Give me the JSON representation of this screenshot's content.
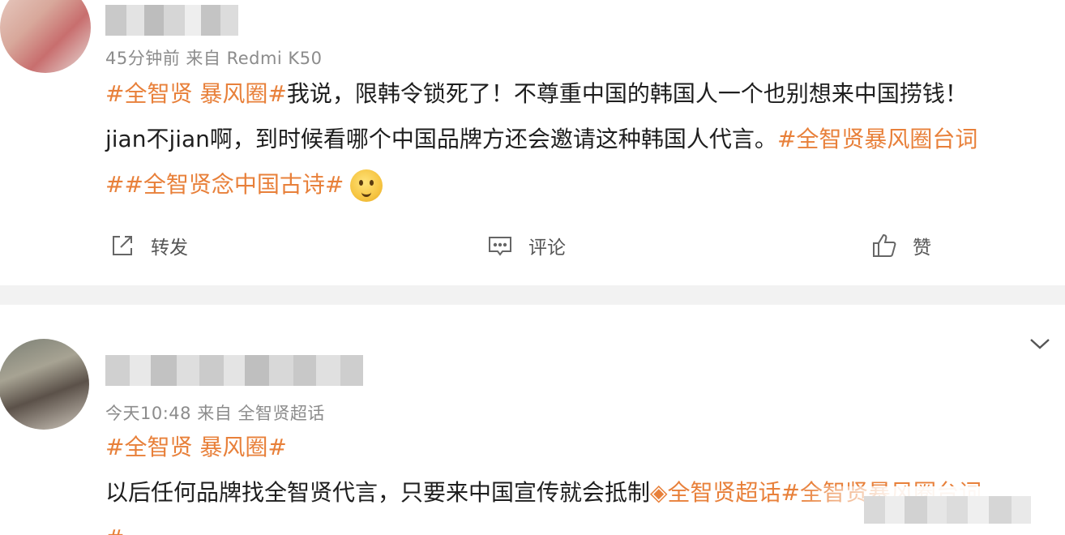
{
  "posts": [
    {
      "meta": "45分钟前  来自 Redmi K50",
      "text_lines": [
        [
          {
            "t": "#全智贤 暴风圈#",
            "tag": true
          },
          {
            "t": "我说，限韩令锁死了！不尊重中国的韩国人一个也别想来中国捞钱！",
            "tag": false
          }
        ],
        [
          {
            "t": "jian不jian啊，到时候看哪个中国品牌方还会邀请这种韩国人代言。",
            "tag": false
          },
          {
            "t": "#全智贤暴风圈台词",
            "tag": true
          }
        ],
        [
          {
            "t": "##全智贤念中国古诗#",
            "tag": true
          }
        ]
      ],
      "actions": {
        "forward_label": "转发",
        "comment_label": "评论",
        "like_label": "赞"
      }
    },
    {
      "meta": "今天10:48  来自 全智贤超话",
      "text_lines": [
        [
          {
            "t": "#全智贤 暴风圈#",
            "tag": true
          }
        ],
        [
          {
            "t": "以后任何品牌找全智贤代言，只要来中国宣传就会抵制",
            "tag": false
          },
          {
            "t": "◈全智贤超话#全智贤暴风圈台词",
            "tag": true
          }
        ],
        [
          {
            "t": "#",
            "tag": true
          }
        ]
      ]
    }
  ],
  "colors": {
    "tag": "#e8803a",
    "meta": "#8c8c8c",
    "divider": "#f2f2f2"
  },
  "icons": [
    "forward-icon",
    "comment-icon",
    "like-icon",
    "emoji-icon",
    "chevron-down-icon"
  ]
}
